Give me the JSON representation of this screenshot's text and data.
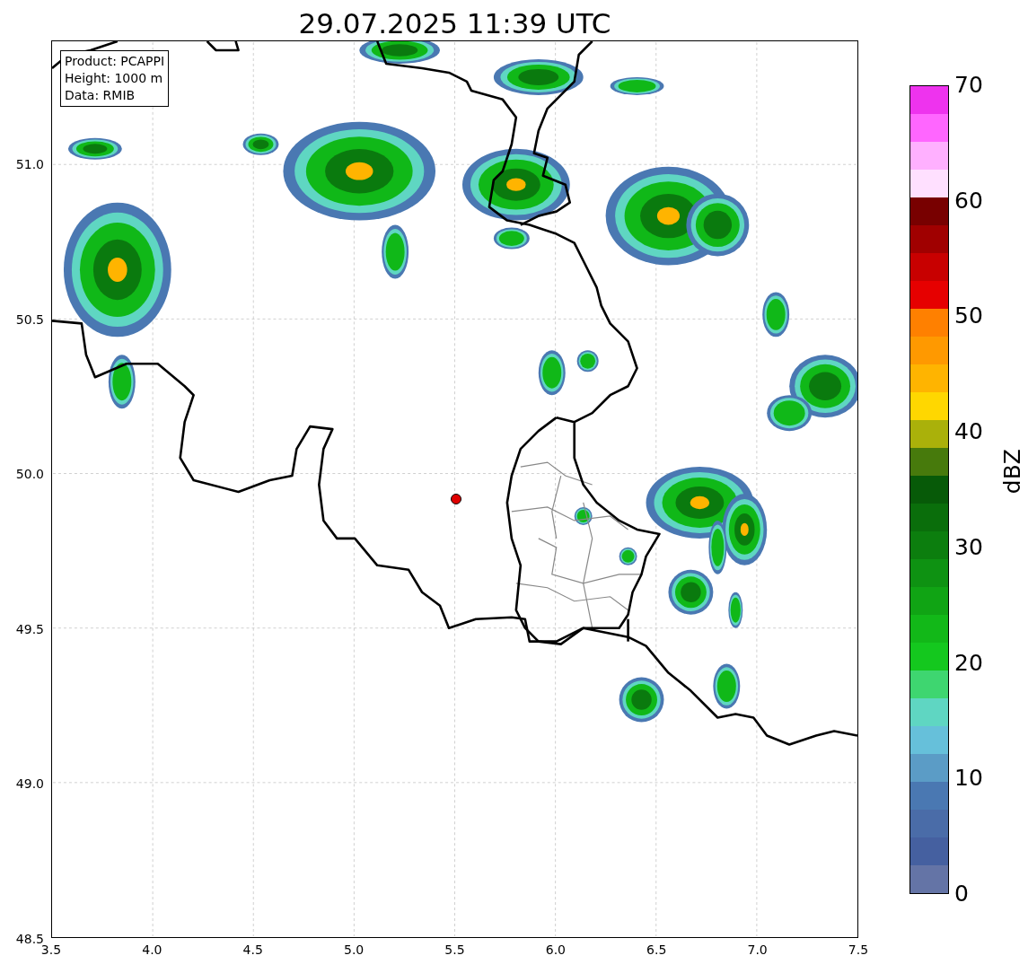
{
  "title": "29.07.2025 11:39 UTC",
  "info_box": {
    "lines": [
      "Product: PCAPPI",
      "Height: 1000 m",
      "Data: RMIB"
    ]
  },
  "x_axis": {
    "ticks": [
      "3.5",
      "4.0",
      "4.5",
      "5.0",
      "5.5",
      "6.0",
      "6.5",
      "7.0",
      "7.5"
    ]
  },
  "y_axis": {
    "ticks": [
      "51.0",
      "50.5",
      "50.0",
      "49.5",
      "49.0",
      "48.5"
    ]
  },
  "colorbar": {
    "label": "dBZ",
    "ticks": [
      "70",
      "60",
      "50",
      "40",
      "30",
      "20",
      "10",
      "0"
    ],
    "bands": [
      {
        "color": "#6474a6"
      },
      {
        "color": "#4560a0"
      },
      {
        "color": "#4a6ca8"
      },
      {
        "color": "#4a78b2"
      },
      {
        "color": "#5b9cc6"
      },
      {
        "color": "#66c0da"
      },
      {
        "color": "#5fd6c2"
      },
      {
        "color": "#3ed670"
      },
      {
        "color": "#14c81e"
      },
      {
        "color": "#12b818"
      },
      {
        "color": "#10a414"
      },
      {
        "color": "#0e9212"
      },
      {
        "color": "#0c7e0e"
      },
      {
        "color": "#0a6e0b"
      },
      {
        "color": "#075a08"
      },
      {
        "color": "#477a0c"
      },
      {
        "color": "#aab10a"
      },
      {
        "color": "#ffd700"
      },
      {
        "color": "#ffb400"
      },
      {
        "color": "#ff9900"
      },
      {
        "color": "#ff8000"
      },
      {
        "color": "#e60000"
      },
      {
        "color": "#c80000"
      },
      {
        "color": "#a00000"
      },
      {
        "color": "#780000"
      },
      {
        "color": "#ffe0ff"
      },
      {
        "color": "#ffb0ff"
      },
      {
        "color": "#ff66ff"
      },
      {
        "color": "#ee33ee"
      }
    ]
  }
}
